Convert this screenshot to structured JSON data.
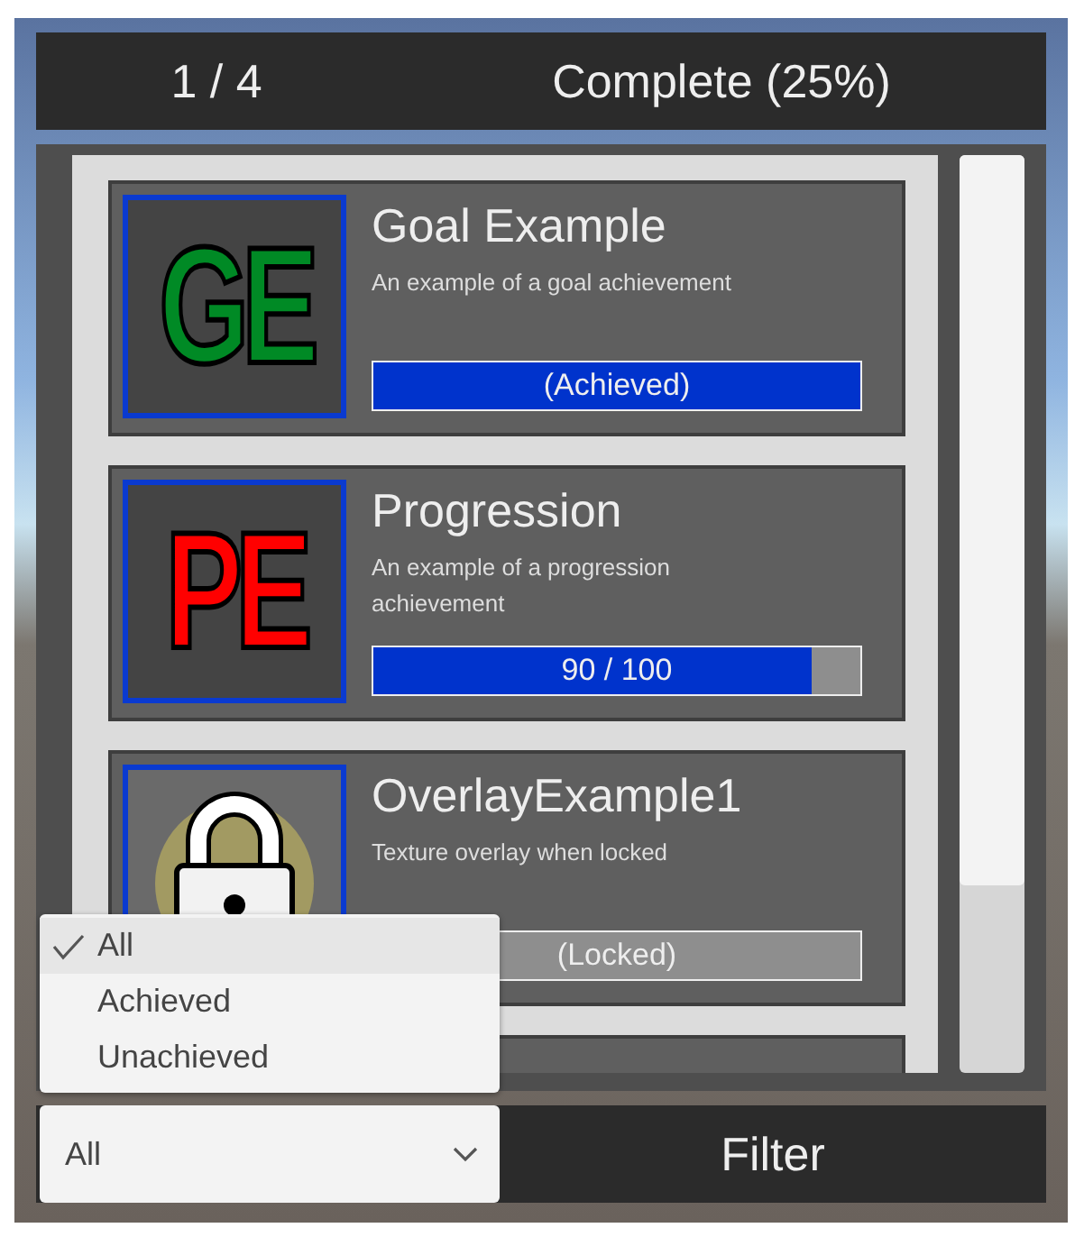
{
  "header": {
    "count": "1 / 4",
    "complete": "Complete (25%)"
  },
  "achievements": [
    {
      "kind": "full",
      "title": "Goal Example",
      "description": "An example of a goal achievement",
      "icon": {
        "kind": "letters",
        "text": "GE",
        "color": "#008a25"
      },
      "level": 1,
      "status": "(Achieved)"
    },
    {
      "kind": "full",
      "title": "Progression",
      "description": "An example of a progression achievement",
      "icon": {
        "kind": "letters",
        "text": "PE",
        "color": "#ff0000"
      },
      "level": 0.9,
      "status": "90 / 100"
    },
    {
      "kind": "full",
      "title": "OverlayExample1",
      "description": "Texture overlay when locked",
      "icon": {
        "kind": "lock"
      },
      "status": "(Locked)"
    },
    {
      "kind": "cut_off"
    }
  ],
  "filter_menu": {
    "options": [
      {
        "label": "All",
        "selected": true
      },
      {
        "label": "Achieved",
        "selected": false
      },
      {
        "label": "Unachieved",
        "selected": false
      }
    ]
  },
  "filter_dropdown": {
    "value": "All"
  },
  "filter_label": "Filter"
}
